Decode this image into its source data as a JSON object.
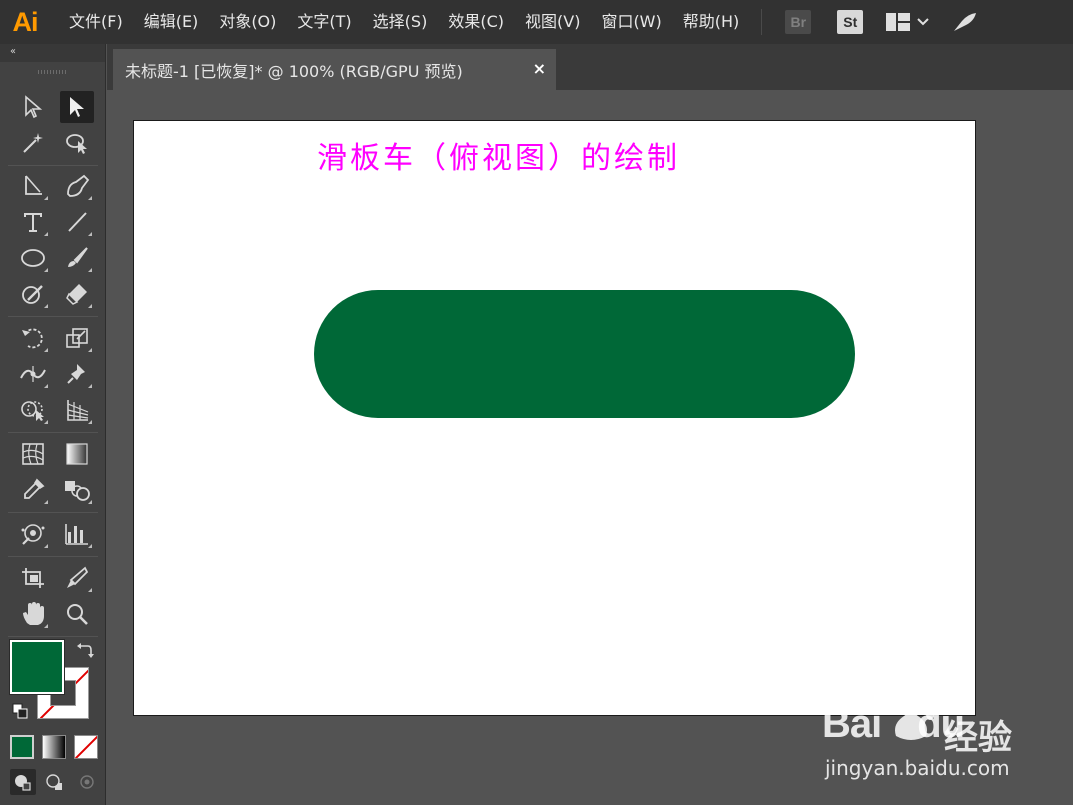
{
  "app": {
    "logo": "Ai"
  },
  "menu": [
    "文件(F)",
    "编辑(E)",
    "对象(O)",
    "文字(T)",
    "选择(S)",
    "效果(C)",
    "视图(V)",
    "窗口(W)",
    "帮助(H)"
  ],
  "bridge": {
    "label": "Br"
  },
  "stock": {
    "label": "St"
  },
  "toolbar": {
    "collapse": "‹‹"
  },
  "document_tab": {
    "title": "未标题-1 [已恢复]* @ 100% (RGB/GPU 预览)",
    "close": "×"
  },
  "artboard": {
    "title": "滑板车（俯视图）的绘制"
  },
  "colors": {
    "fill": "#006837",
    "title_text": "#ff00ff",
    "menu_bg": "#323232",
    "panel_bg": "#424242",
    "canvas_bg": "#535353"
  },
  "watermark": {
    "logo": "Bai",
    "logo2": "du",
    "cn": "经验",
    "url": "jingyan.baidu.com"
  }
}
